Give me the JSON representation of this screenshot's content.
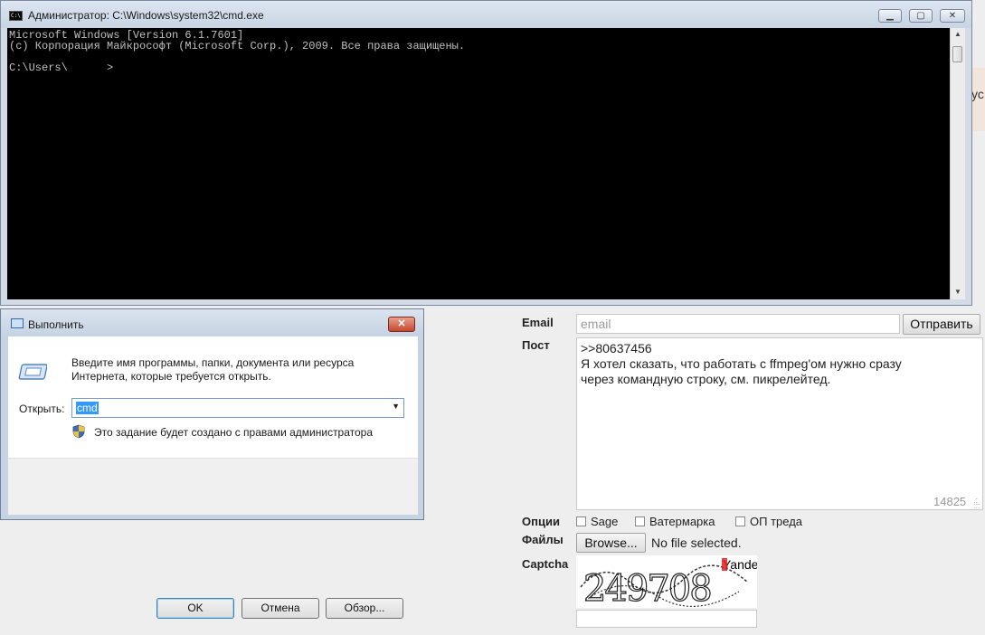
{
  "cmd": {
    "title": "Администратор: C:\\Windows\\system32\\cmd.exe",
    "icon_label": "C:\\",
    "controls": {
      "minimize": "▁",
      "maximize": "▢",
      "close": "✕"
    },
    "console_lines": [
      "Microsoft Windows [Version 6.1.7601]",
      "(c) Корпорация Майкрософт (Microsoft Corp.), 2009. Все права защищены.",
      "",
      "C:\\Users\\      >"
    ]
  },
  "run_dialog": {
    "title": "Выполнить",
    "close": "✕",
    "description": "Введите имя программы, папки, документа или ресурса",
    "description_2": "Интернета, которые требуется открыть.",
    "open_label": "Открыть:",
    "open_value": "cmd",
    "admin_note": "Это задание будет создано с правами администратора",
    "ok": "OK",
    "cancel": "Отмена",
    "browse": "Обзор..."
  },
  "form": {
    "email_label": "Email",
    "email_placeholder": "email",
    "send": "Отправить",
    "post_label": "Пост",
    "post_lines": [
      ">>80637456",
      "Я хотел сказать, что работать с ffmpeg'ом нужно сразу",
      "через командную строку, см. пикрелейтед."
    ],
    "counter": "14825",
    "options_label": "Опции",
    "options": [
      "Sage",
      "Ватермарка",
      "ОП треда"
    ],
    "files_label": "Файлы",
    "browse": "Browse...",
    "no_file": "No file selected.",
    "captcha_label": "Captcha",
    "captcha_text": "249708",
    "captcha_brand": "Yandex"
  },
  "background": {
    "cut_text": "ус"
  }
}
